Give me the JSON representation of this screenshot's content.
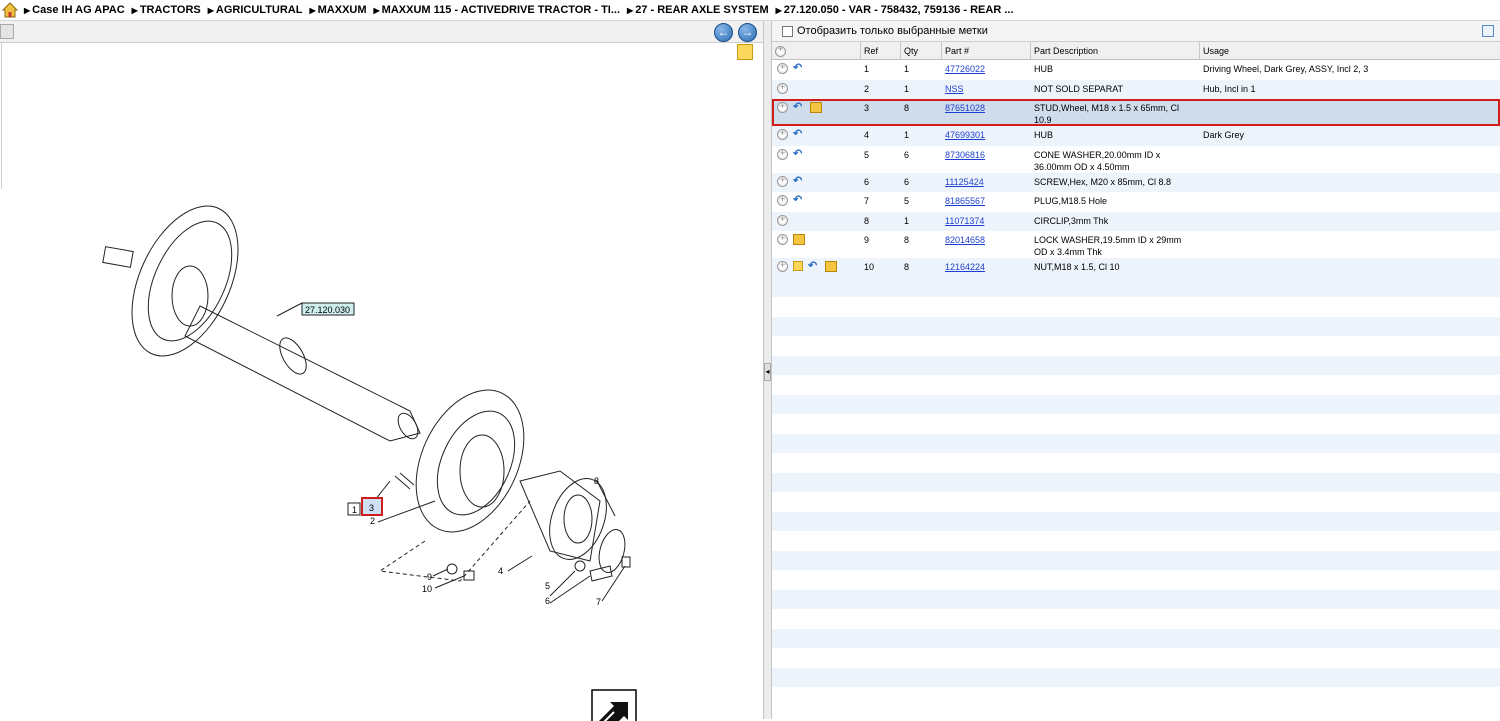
{
  "breadcrumb": [
    "Case IH AG APAC",
    "TRACTORS",
    "AGRICULTURAL",
    "MAXXUM",
    "MAXXUM 115 - ACTIVEDRIVE TRACTOR - TI...",
    "27 - REAR AXLE SYSTEM",
    "27.120.050 - VAR - 758432, 759136 - REAR ..."
  ],
  "left": {
    "nav_back": "←",
    "nav_forward": "→",
    "callouts": {
      "ref_box": "27.120.030",
      "c1": "1",
      "c2": "2",
      "c3": "3",
      "c4": "4",
      "c5": "5",
      "c6": "6",
      "c7": "7",
      "c8": "8",
      "c9": "9",
      "c10": "10"
    }
  },
  "filter": {
    "label": "Отобразить только выбранные метки"
  },
  "grid": {
    "headers": {
      "ref": "Ref",
      "qty": "Qty",
      "part": "Part #",
      "desc": "Part Description",
      "usage": "Usage"
    },
    "rows": [
      {
        "ref": "1",
        "qty": "1",
        "part": "47726022",
        "desc": "HUB",
        "usage": "Driving Wheel, Dark Grey, ASSY, Incl 2, 3",
        "icons": [
          "plus",
          "link"
        ]
      },
      {
        "ref": "2",
        "qty": "1",
        "part": "NSS",
        "desc": "NOT SOLD SEPARAT",
        "usage": "Hub, Incl in 1",
        "icons": [
          "plus"
        ]
      },
      {
        "ref": "3",
        "qty": "8",
        "part": "87651028",
        "desc": "STUD,Wheel, M18 x 1.5 x 65mm, Cl 10.9",
        "usage": "",
        "icons": [
          "plus",
          "link",
          "box"
        ],
        "selected": true
      },
      {
        "ref": "4",
        "qty": "1",
        "part": "47699301",
        "desc": "HUB",
        "usage": "Dark Grey",
        "icons": [
          "plus",
          "link"
        ]
      },
      {
        "ref": "5",
        "qty": "6",
        "part": "87306816",
        "desc": "CONE WASHER,20.00mm ID x 36.00mm OD x 4.50mm",
        "usage": "",
        "icons": [
          "plus",
          "link"
        ]
      },
      {
        "ref": "6",
        "qty": "6",
        "part": "11125424",
        "desc": "SCREW,Hex, M20 x 85mm, Cl 8.8",
        "usage": "",
        "icons": [
          "plus",
          "link"
        ]
      },
      {
        "ref": "7",
        "qty": "5",
        "part": "81865567",
        "desc": "PLUG,M18.5 Hole",
        "usage": "",
        "icons": [
          "plus",
          "link"
        ]
      },
      {
        "ref": "8",
        "qty": "1",
        "part": "11071374",
        "desc": "CIRCLIP,3mm Thk",
        "usage": "",
        "icons": [
          "plus"
        ]
      },
      {
        "ref": "9",
        "qty": "8",
        "part": "82014658",
        "desc": "LOCK WASHER,19.5mm ID x 29mm OD x 3.4mm Thk",
        "usage": "",
        "icons": [
          "plus",
          "box"
        ]
      },
      {
        "ref": "10",
        "qty": "8",
        "part": "12164224",
        "desc": "NUT,M18 x 1.5, Cl 10",
        "usage": "",
        "icons": [
          "plus",
          "note",
          "link",
          "box"
        ]
      }
    ]
  }
}
